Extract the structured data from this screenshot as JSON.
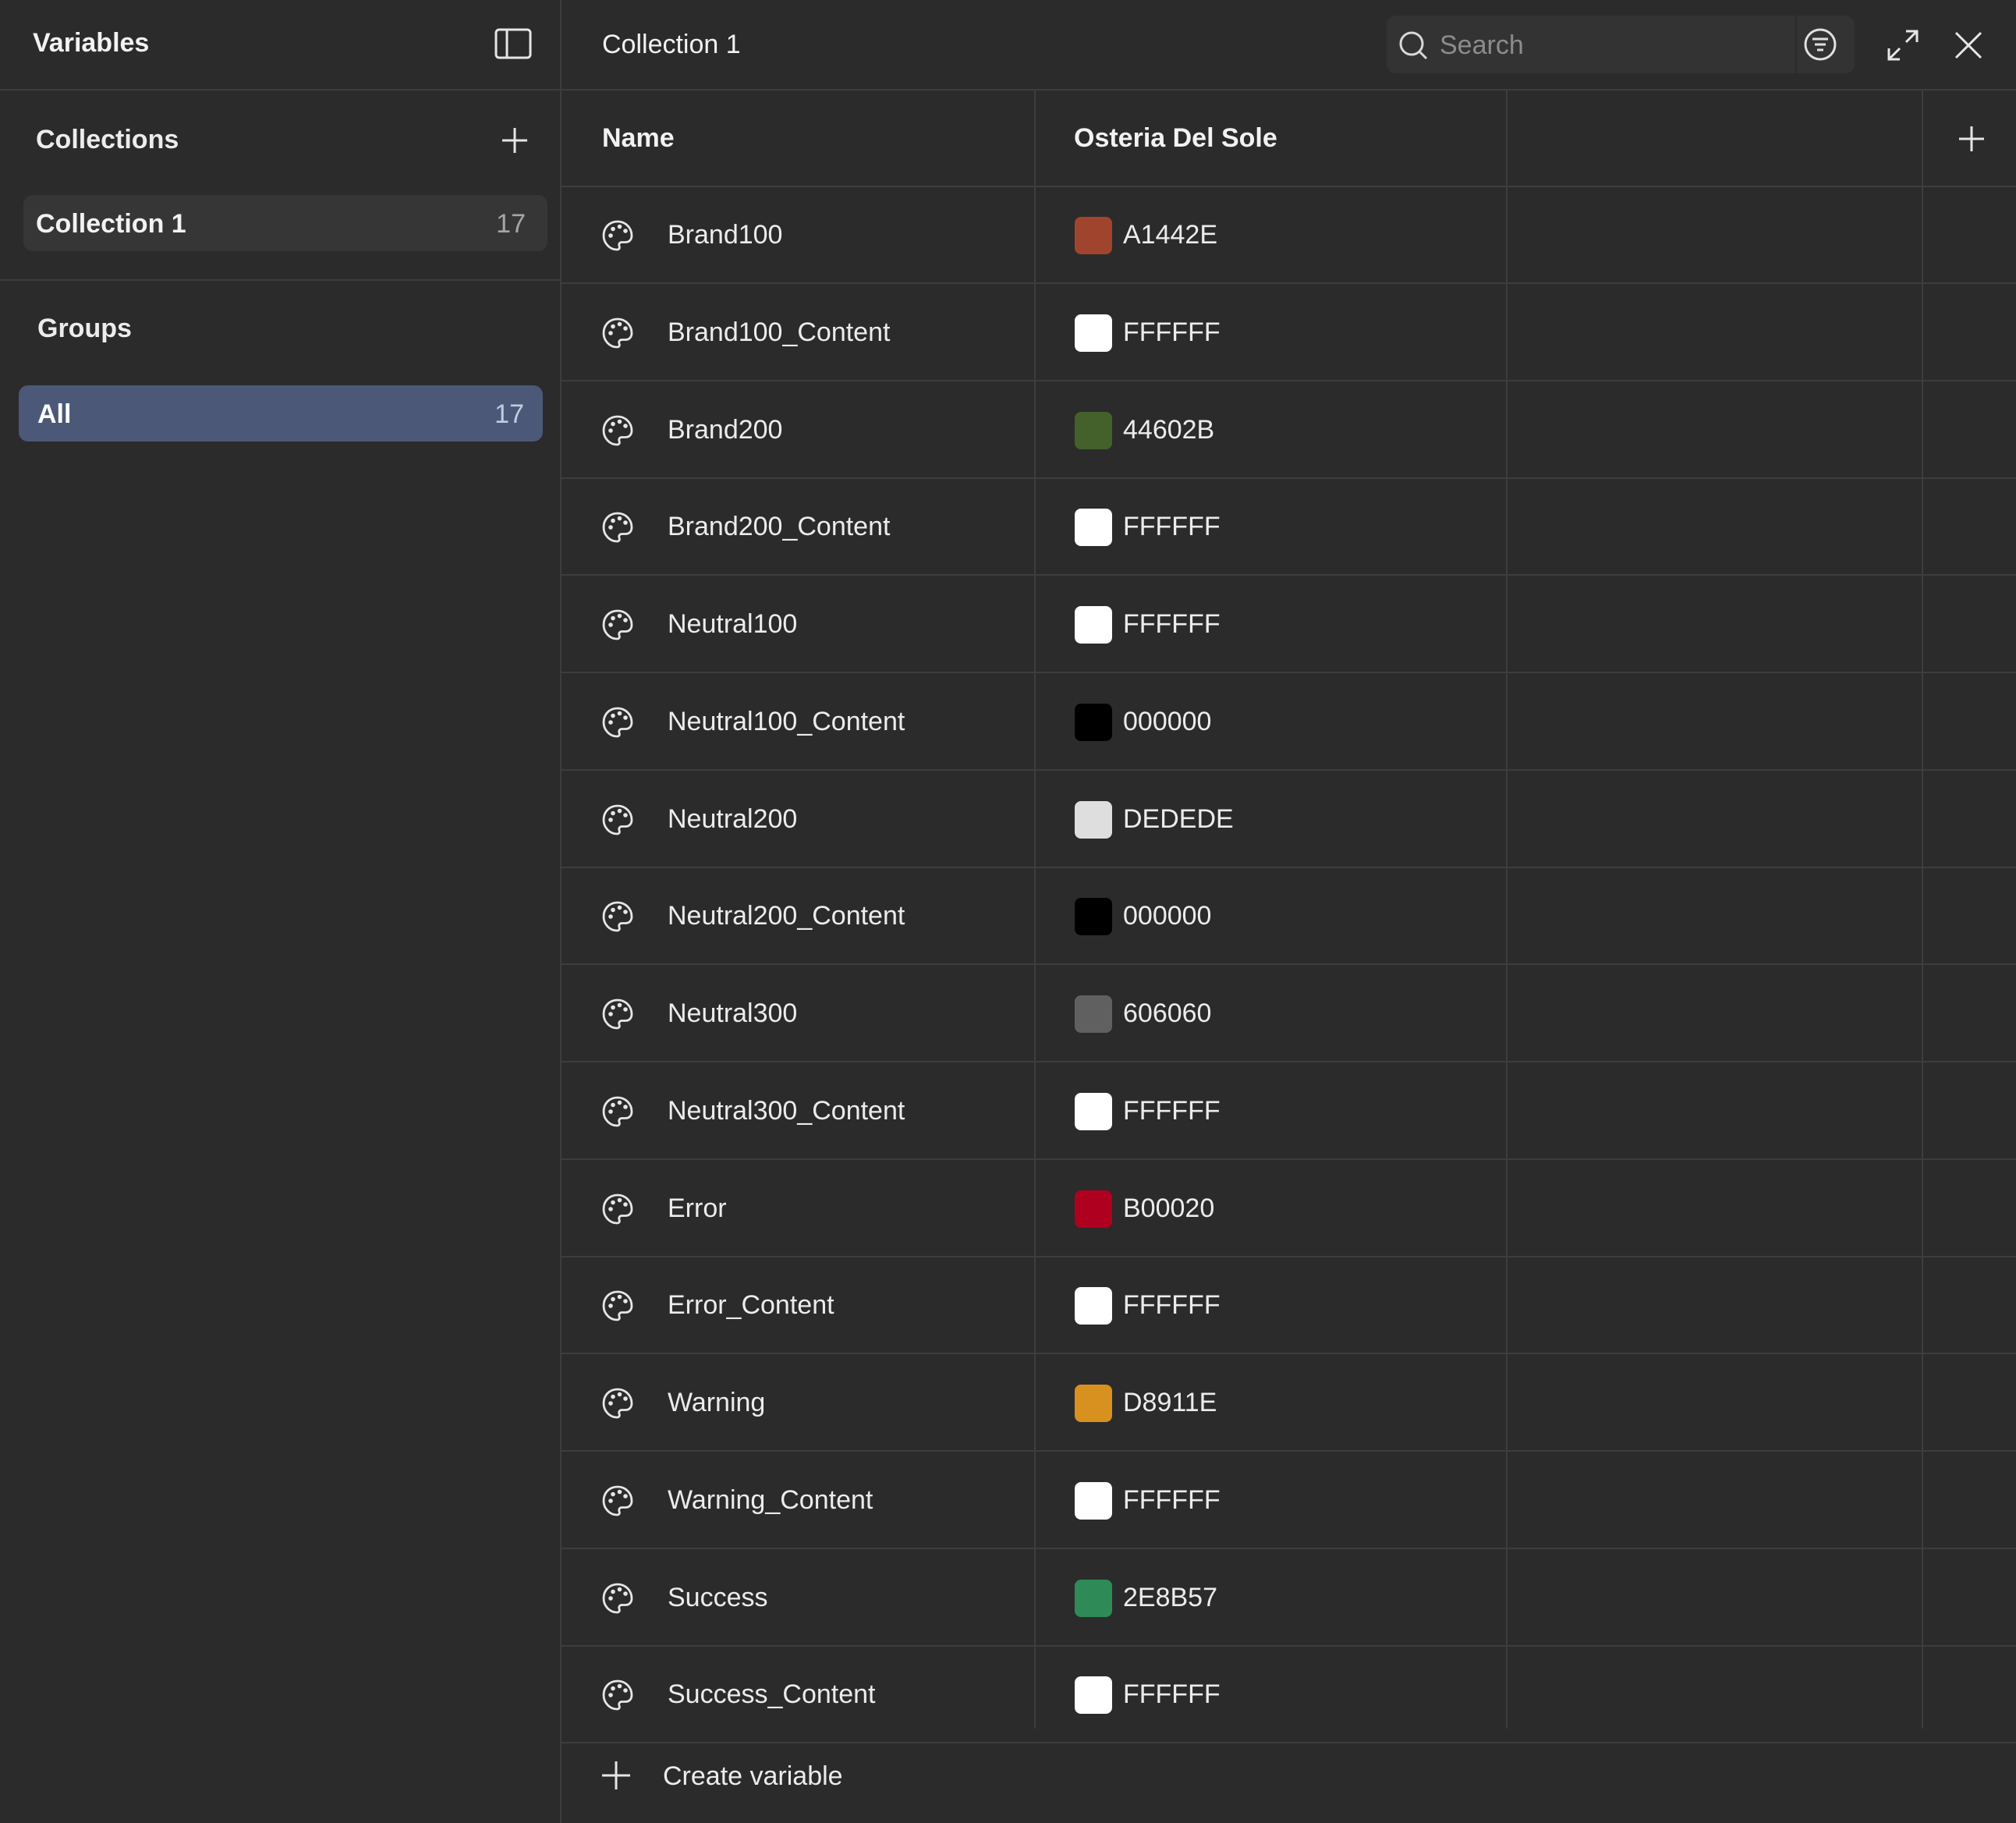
{
  "sidebar": {
    "title": "Variables",
    "collections_label": "Collections",
    "collections": [
      {
        "label": "Collection 1",
        "count": "17"
      }
    ],
    "groups_label": "Groups",
    "groups": [
      {
        "label": "All",
        "count": "17"
      }
    ]
  },
  "header": {
    "title": "Collection 1",
    "search_placeholder": "Search"
  },
  "table": {
    "columns": {
      "name": "Name",
      "mode": "Osteria Del Sole"
    },
    "rows": [
      {
        "name": "Brand100",
        "value": "A1442E",
        "color": "#A1442E"
      },
      {
        "name": "Brand100_Content",
        "value": "FFFFFF",
        "color": "#FFFFFF"
      },
      {
        "name": "Brand200",
        "value": "44602B",
        "color": "#44602B"
      },
      {
        "name": "Brand200_Content",
        "value": "FFFFFF",
        "color": "#FFFFFF"
      },
      {
        "name": "Neutral100",
        "value": "FFFFFF",
        "color": "#FFFFFF"
      },
      {
        "name": "Neutral100_Content",
        "value": "000000",
        "color": "#000000"
      },
      {
        "name": "Neutral200",
        "value": "DEDEDE",
        "color": "#DEDEDE"
      },
      {
        "name": "Neutral200_Content",
        "value": "000000",
        "color": "#000000"
      },
      {
        "name": "Neutral300",
        "value": "606060",
        "color": "#606060"
      },
      {
        "name": "Neutral300_Content",
        "value": "FFFFFF",
        "color": "#FFFFFF"
      },
      {
        "name": "Error",
        "value": "B00020",
        "color": "#B00020"
      },
      {
        "name": "Error_Content",
        "value": "FFFFFF",
        "color": "#FFFFFF"
      },
      {
        "name": "Warning",
        "value": "D8911E",
        "color": "#D8911E"
      },
      {
        "name": "Warning_Content",
        "value": "FFFFFF",
        "color": "#FFFFFF"
      },
      {
        "name": "Success",
        "value": "2E8B57",
        "color": "#2E8B57"
      },
      {
        "name": "Success_Content",
        "value": "FFFFFF",
        "color": "#FFFFFF"
      }
    ],
    "row_icon": "palette-icon"
  },
  "footer": {
    "create_label": "Create variable"
  },
  "theme": {
    "background": "#2b2b2b",
    "selected_group": "#4b5878",
    "border": "#3d3d3d"
  }
}
